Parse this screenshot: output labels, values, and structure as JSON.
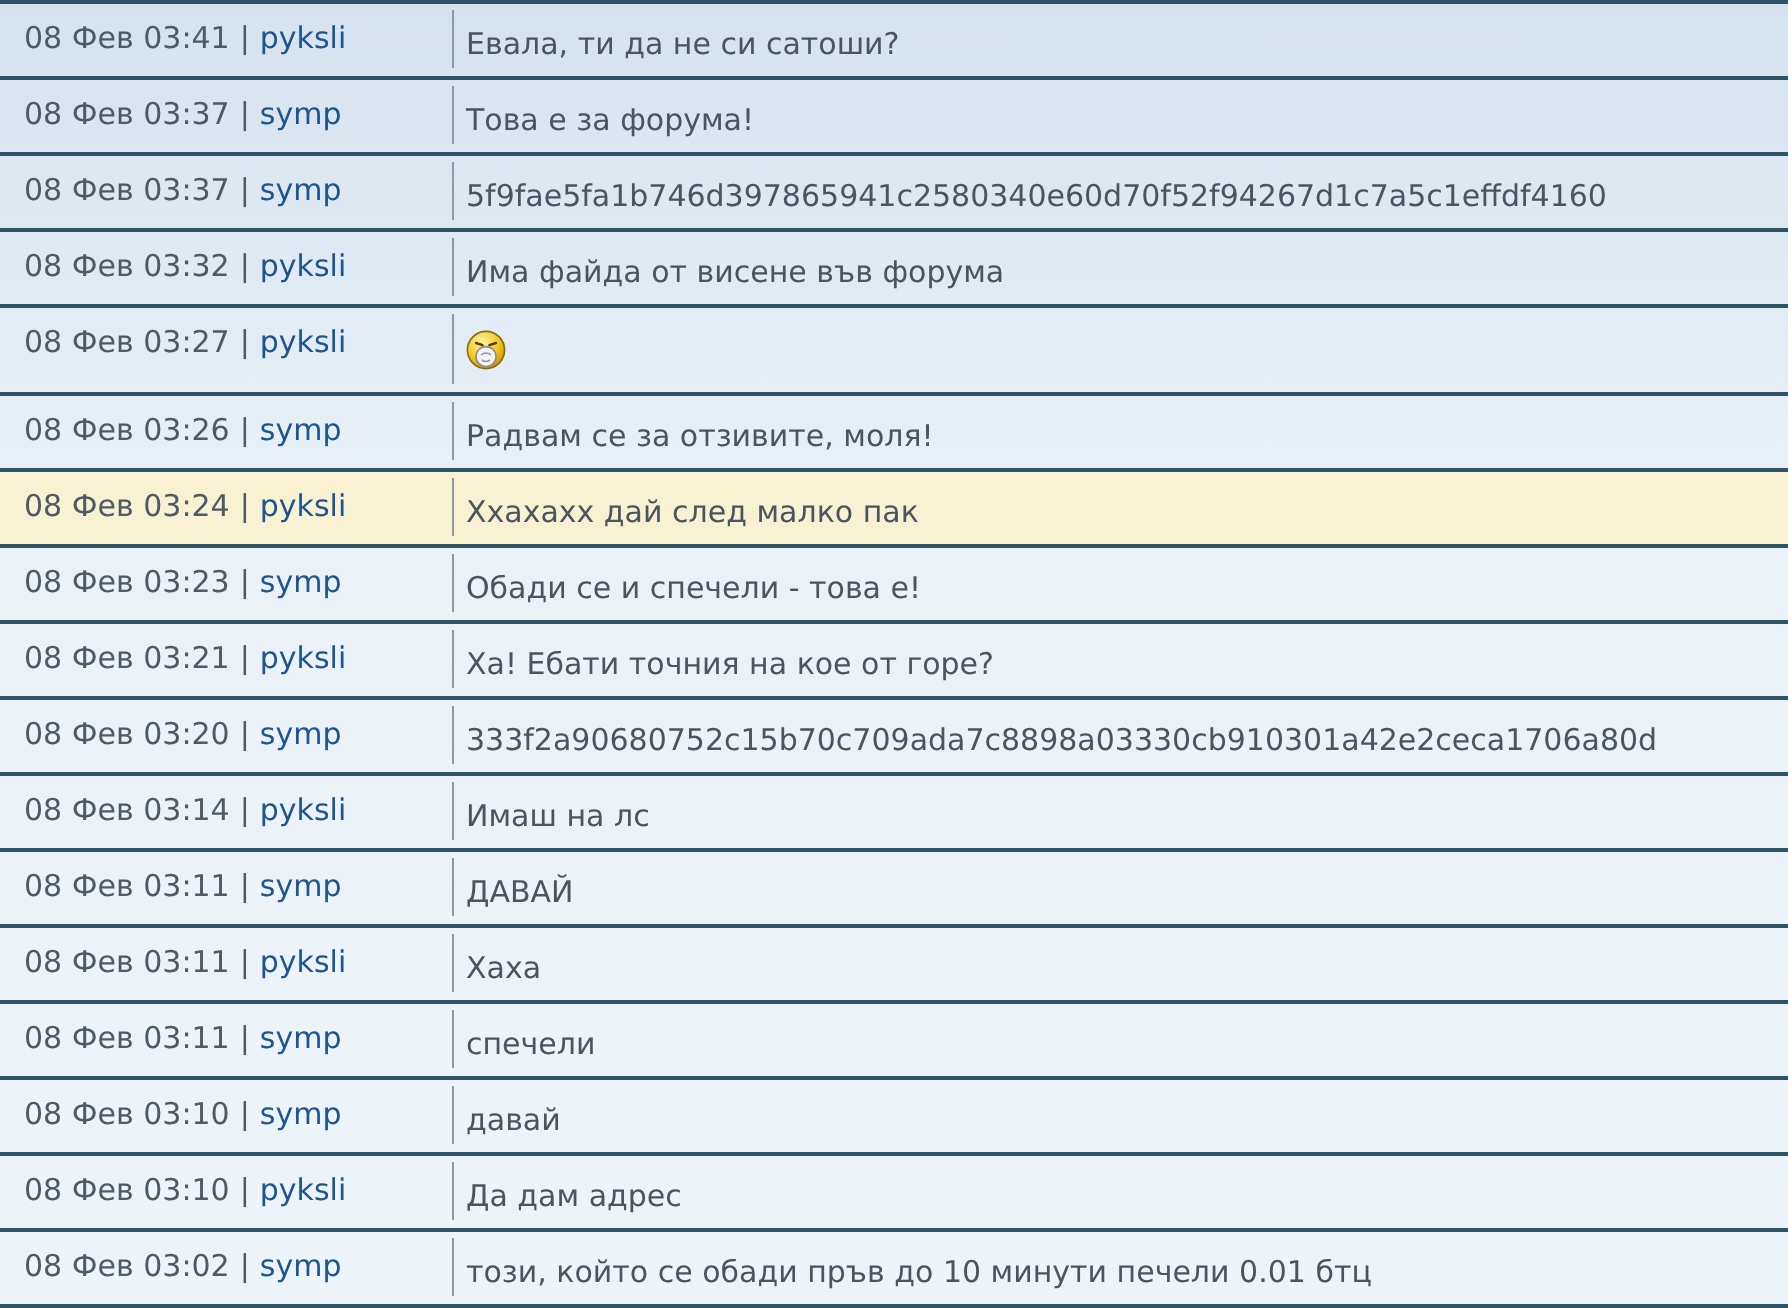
{
  "rows": [
    {
      "time": "08 Фев 03:41",
      "separator": "|",
      "user": "pyksli",
      "kind": "text",
      "message": "Евала, ти да не си сатоши?",
      "highlighted": false
    },
    {
      "time": "08 Фев 03:37",
      "separator": "|",
      "user": "symp",
      "kind": "text",
      "message": "Това е за форума!",
      "highlighted": false
    },
    {
      "time": "08 Фев 03:37",
      "separator": "|",
      "user": "symp",
      "kind": "text",
      "message": "5f9fae5fa1b746d397865941c2580340e60d70f52f94267d1c7a5c1effdf4160",
      "highlighted": false
    },
    {
      "time": "08 Фев 03:32",
      "separator": "|",
      "user": "pyksli",
      "kind": "text",
      "message": "Има файда от висене във форума",
      "highlighted": false
    },
    {
      "time": "08 Фев 03:27",
      "separator": "|",
      "user": "pyksli",
      "kind": "emoji",
      "highlighted": false
    },
    {
      "time": "08 Фев 03:26",
      "separator": "|",
      "user": "symp",
      "kind": "text",
      "message": "Радвам се за отзивите, моля!",
      "highlighted": false
    },
    {
      "time": "08 Фев 03:24",
      "separator": "|",
      "user": "pyksli",
      "kind": "text",
      "message": "Ххахахх дай след малко пак",
      "highlighted": true
    },
    {
      "time": "08 Фев 03:23",
      "separator": "|",
      "user": "symp",
      "kind": "text",
      "message": "Обади се и спечели - това е!",
      "highlighted": false
    },
    {
      "time": "08 Фев 03:21",
      "separator": "|",
      "user": "pyksli",
      "kind": "text",
      "message": "Ха! Ебати точния на кое от горе?",
      "highlighted": false
    },
    {
      "time": "08 Фев 03:20",
      "separator": "|",
      "user": "symp",
      "kind": "text",
      "message": "333f2a90680752c15b70c709ada7c8898a03330cb910301a42e2ceca1706a80d",
      "highlighted": false
    },
    {
      "time": "08 Фев 03:14",
      "separator": "|",
      "user": "pyksli",
      "kind": "text",
      "message": "Имаш на лс",
      "highlighted": false
    },
    {
      "time": "08 Фев 03:11",
      "separator": "|",
      "user": "symp",
      "kind": "text",
      "message": "ДАВАЙ",
      "highlighted": false
    },
    {
      "time": "08 Фев 03:11",
      "separator": "|",
      "user": "pyksli",
      "kind": "text",
      "message": "Хаха",
      "highlighted": false
    },
    {
      "time": "08 Фев 03:11",
      "separator": "|",
      "user": "symp",
      "kind": "text",
      "message": "спечели",
      "highlighted": false
    },
    {
      "time": "08 Фев 03:10",
      "separator": "|",
      "user": "symp",
      "kind": "text",
      "message": "давай",
      "highlighted": false
    },
    {
      "time": "08 Фев 03:10",
      "separator": "|",
      "user": "pyksli",
      "kind": "text",
      "message": "Да дам адрес",
      "highlighted": false
    },
    {
      "time": "08 Фев 03:02",
      "separator": "|",
      "user": "symp",
      "kind": "text",
      "message": "този, който се обади пръв до 10 минути печели 0.01 бтц",
      "highlighted": false
    }
  ]
}
